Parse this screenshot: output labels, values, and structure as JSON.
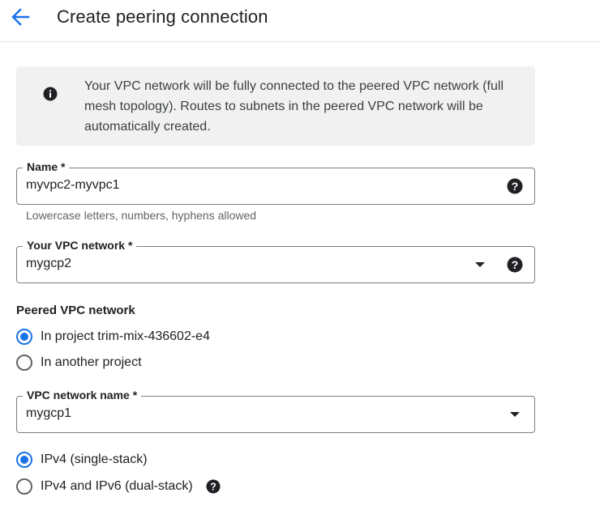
{
  "header": {
    "title": "Create peering connection",
    "back_icon": "arrow-back-icon"
  },
  "info_banner": {
    "icon": "info-icon",
    "text": "Your VPC network will be fully connected to the peered VPC network (full mesh topology). Routes to subnets in the peered VPC network will be automatically created."
  },
  "name_field": {
    "label": "Name *",
    "value": "myvpc2-myvpc1",
    "hint": "Lowercase letters, numbers, hyphens allowed",
    "help_icon": "help-icon"
  },
  "your_vpc": {
    "label": "Your VPC network *",
    "value": "mygcp2",
    "icons": [
      "dropdown-caret-icon",
      "help-icon"
    ]
  },
  "peered_vpc": {
    "section_title": "Peered VPC network",
    "options": [
      {
        "label": "In project trim-mix-436602-e4",
        "selected": true
      },
      {
        "label": "In another project",
        "selected": false
      }
    ]
  },
  "vpc_network_name": {
    "label": "VPC network name *",
    "value": "mygcp1",
    "icon": "dropdown-caret-icon"
  },
  "stack_type": {
    "options": [
      {
        "label": "IPv4 (single-stack)",
        "selected": true
      },
      {
        "label": "IPv4 and IPv6 (dual-stack)",
        "selected": false
      }
    ],
    "help_icon": "help-icon"
  },
  "colors": {
    "accent": "#1a73e8",
    "banner_bg": "#f1f1f1",
    "border": "#7d7d7d"
  }
}
